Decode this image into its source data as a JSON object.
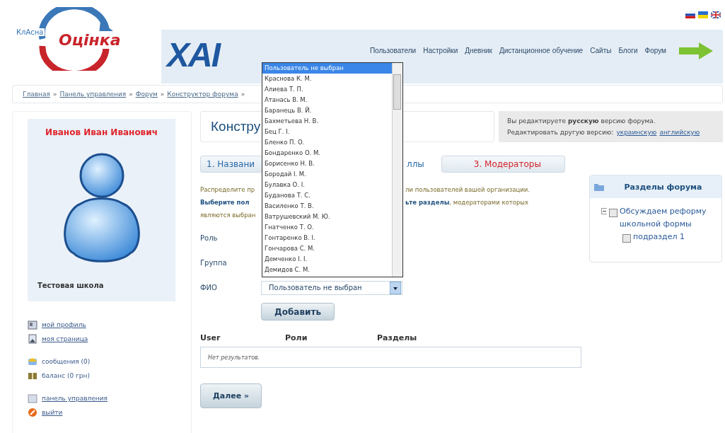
{
  "logo": {
    "top": "КлАсна",
    "main": "Оцінка"
  },
  "banner": {
    "logo": "XAI",
    "nav": [
      "Пользователи",
      "Настройки",
      "Дневник",
      "Дистанционное обучение",
      "Сайты",
      "Блоги",
      "Форум"
    ]
  },
  "breadcrumbs": [
    {
      "label": "Главная",
      "sep": "»"
    },
    {
      "label": "Панель управления",
      "sep": "»"
    },
    {
      "label": "Форум",
      "sep": "»"
    },
    {
      "label": "Конструктор форума",
      "sep": "»"
    }
  ],
  "profile": {
    "name": "Иванов Иван Иванович",
    "school": "Тестовая школа"
  },
  "link_groups": [
    [
      {
        "kind": "profile",
        "label": "мой профиль"
      },
      {
        "kind": "page",
        "label": "моя страница"
      }
    ],
    [
      {
        "kind": "messages",
        "label": "сообщения (0)"
      },
      {
        "kind": "balance",
        "label": "баланс (0 грн)"
      }
    ],
    [
      {
        "kind": "control",
        "label": "панель управления"
      },
      {
        "kind": "logout",
        "label": "выйти"
      }
    ]
  ],
  "heading": "Констру",
  "info": {
    "line1": "Вы редактируете **русскую** версию форума.",
    "line2": "Редактировать другую версию:",
    "links": [
      "украинскую",
      "английскую"
    ]
  },
  "steps": [
    {
      "label": "1. Названи",
      "selected": false
    },
    {
      "label": "ллы",
      "selected": false
    },
    {
      "label": "3. Модераторы",
      "selected": true
    }
  ],
  "intro": [
    {
      "left": "Распределите пр",
      "left_bold": false,
      "right": "ли пользователей вашей организации."
    },
    {
      "left": "Выберите пол",
      "left_bold": true,
      "right": "**ьте разделы**, модераторами которых"
    },
    {
      "left": "являются выбран",
      "left_bold": false
    }
  ],
  "form": {
    "fields": [
      {
        "label": "Роль"
      },
      {
        "label": "Группа"
      },
      {
        "label": "ФИО",
        "value": "Пользователь не выбран"
      }
    ],
    "options": [
      {
        "label": "Пользователь не выбран",
        "selected": true
      },
      {
        "label": "Краснова К. М.",
        "selected": false
      },
      {
        "label": "Алиева Т. П.",
        "selected": false
      },
      {
        "label": "Атанась В. М.",
        "selected": false
      },
      {
        "label": "Баранець В. Й.",
        "selected": false
      },
      {
        "label": "Бахметьева Н. В.",
        "selected": false
      },
      {
        "label": "Бец Г. І.",
        "selected": false
      },
      {
        "label": "Бленко П. О.",
        "selected": false
      },
      {
        "label": "Бондаренко О. М.",
        "selected": false
      },
      {
        "label": "Борисенко Н. В.",
        "selected": false
      },
      {
        "label": "Бородай І. М.",
        "selected": false
      },
      {
        "label": "Булавка О. І.",
        "selected": false
      },
      {
        "label": "Буданова Т. С.",
        "selected": false
      },
      {
        "label": "Василенко Т. В.",
        "selected": false
      },
      {
        "label": "Ватрушевский М. Ю.",
        "selected": false
      },
      {
        "label": "Гнатченко Т. О.",
        "selected": false
      },
      {
        "label": "Гонтаренко В. І.",
        "selected": false
      },
      {
        "label": "Гончарова С. М.",
        "selected": false
      },
      {
        "label": "Демченко І. І.",
        "selected": false
      },
      {
        "label": "Демидов С. М.",
        "selected": false
      }
    ],
    "add_button": "Добавить"
  },
  "table": {
    "columns": [
      "User",
      "Роли",
      "Разделы"
    ],
    "empty": "Нет результатов."
  },
  "next_button": "Далее »",
  "sections": {
    "title": "Разделы форума",
    "tree": [
      {
        "label": "Обсуждаем реформу школьной формы",
        "checked": false,
        "expanded": true,
        "children": [
          {
            "label": "подраздел 1",
            "checked": false
          }
        ]
      }
    ]
  }
}
